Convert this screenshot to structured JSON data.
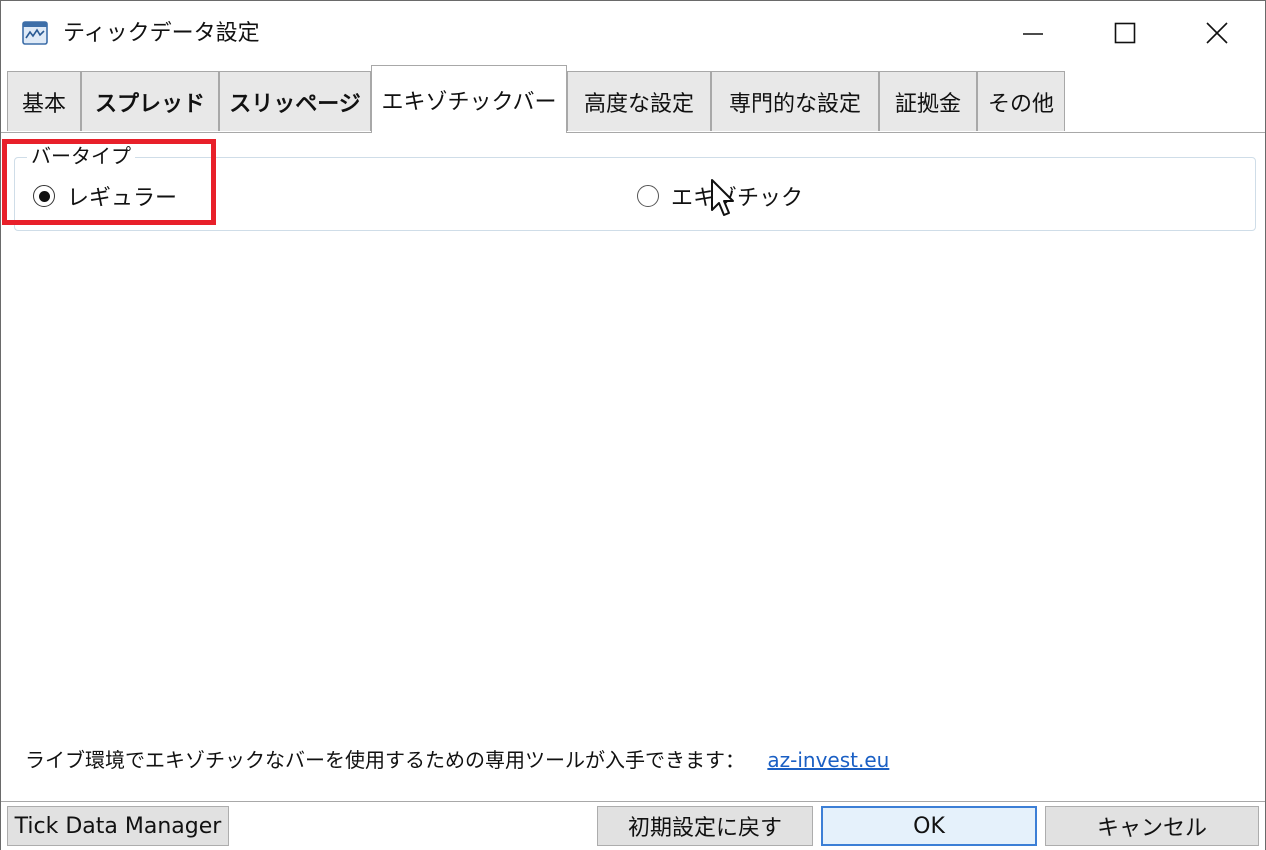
{
  "window": {
    "title": "ティックデータ設定",
    "controls": {
      "minimize": "minimize-icon",
      "maximize": "maximize-icon",
      "close": "close-icon"
    }
  },
  "tabs": [
    {
      "label": "基本",
      "active": false
    },
    {
      "label": "スプレッド",
      "active": false
    },
    {
      "label": "スリッページ",
      "active": false
    },
    {
      "label": "エキゾチックバー",
      "active": true
    },
    {
      "label": "高度な設定",
      "active": false
    },
    {
      "label": "専門的な設定",
      "active": false
    },
    {
      "label": "証拠金",
      "active": false
    },
    {
      "label": "その他",
      "active": false
    }
  ],
  "bar_type": {
    "legend": "バータイプ",
    "options": [
      {
        "label": "レギュラー",
        "checked": true
      },
      {
        "label": "エキゾチック",
        "checked": false
      }
    ]
  },
  "footer": {
    "note": "ライブ環境でエキゾチックなバーを使用するための専用ツールが入手できます：",
    "link": "az-invest.eu"
  },
  "buttons": {
    "tick_data_manager": "Tick Data Manager",
    "reset": "初期設定に戻す",
    "ok": "OK",
    "cancel": "キャンセル"
  },
  "colors": {
    "highlight": "#e8202a",
    "link": "#1a5fc4",
    "default_button_border": "#3c7fd6"
  }
}
